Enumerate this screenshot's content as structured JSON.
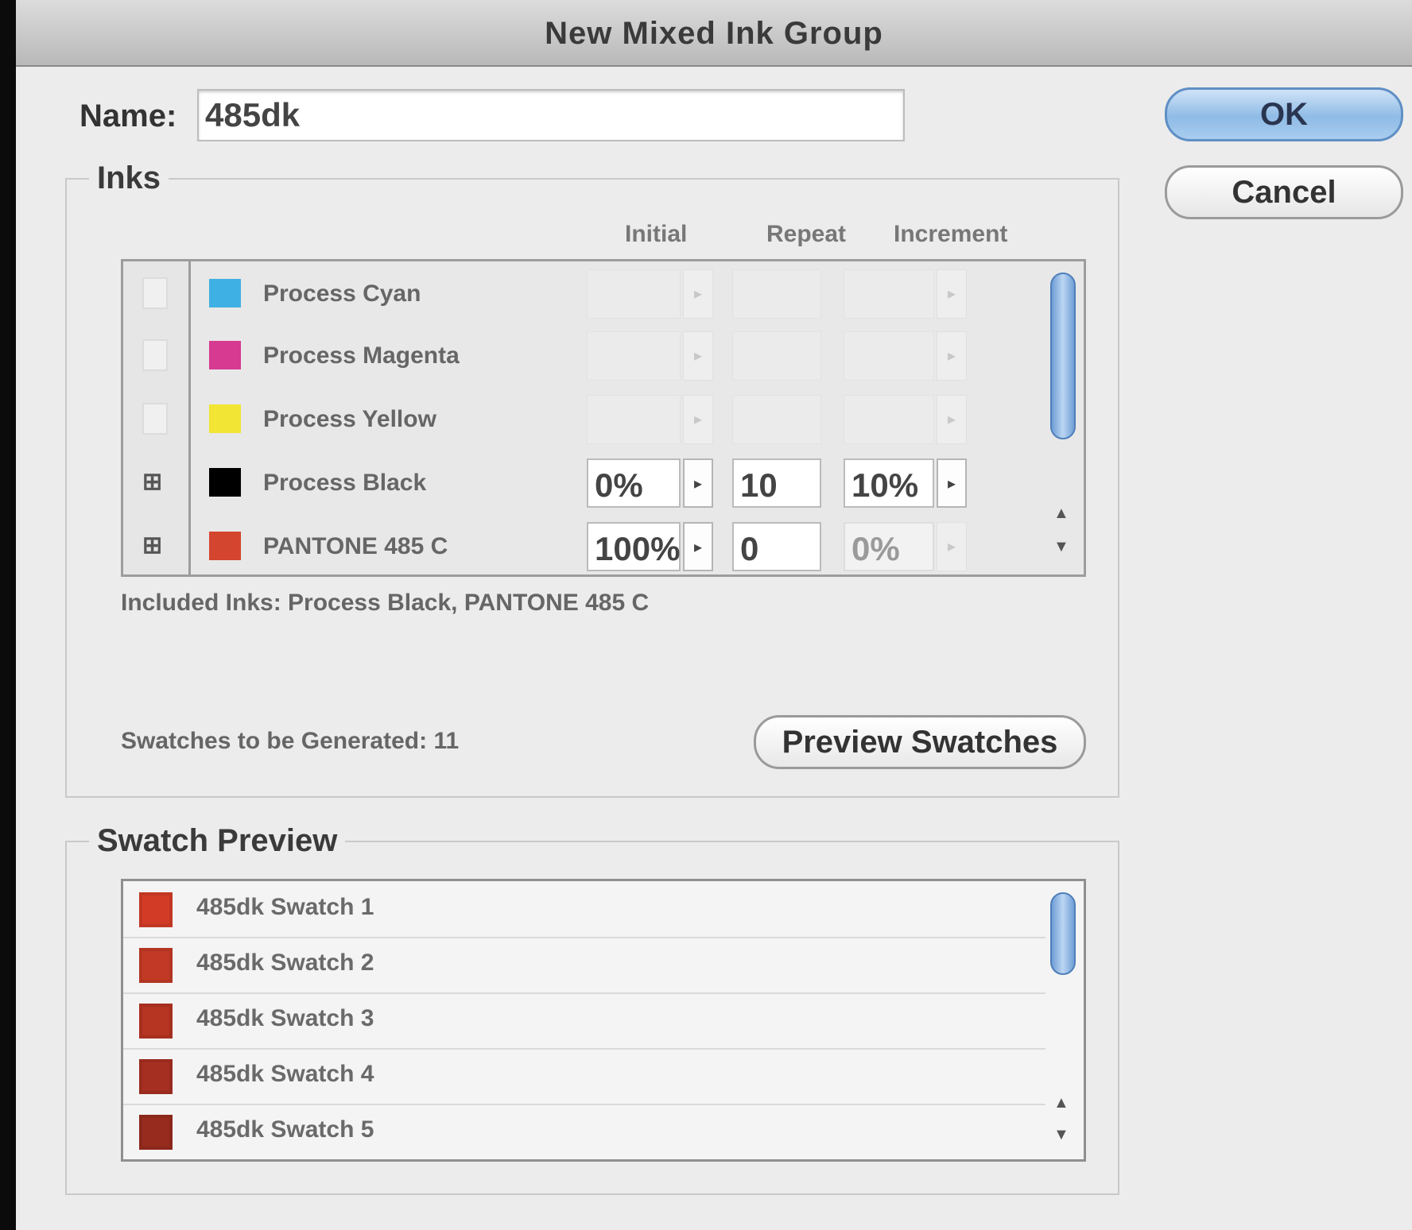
{
  "window": {
    "title": "New Mixed Ink Group"
  },
  "name": {
    "label": "Name:",
    "value": "485dk"
  },
  "buttons": {
    "ok": "OK",
    "cancel": "Cancel",
    "preview": "Preview Swatches"
  },
  "inks": {
    "group_title": "Inks",
    "columns": {
      "initial": "Initial",
      "repeat": "Repeat",
      "increment": "Increment"
    },
    "rows": [
      {
        "name": "Process Cyan",
        "color": "#3fb0e3",
        "included": false,
        "initial": "",
        "repeat": "",
        "increment": ""
      },
      {
        "name": "Process Magenta",
        "color": "#d63a91",
        "included": false,
        "initial": "",
        "repeat": "",
        "increment": ""
      },
      {
        "name": "Process Yellow",
        "color": "#f2e533",
        "included": false,
        "initial": "",
        "repeat": "",
        "increment": ""
      },
      {
        "name": "Process Black",
        "color": "#000000",
        "included": true,
        "initial": "0%",
        "repeat": "10",
        "increment": "10%"
      },
      {
        "name": "PANTONE 485 C",
        "color": "#d4452f",
        "included": true,
        "initial": "100%",
        "repeat": "0",
        "increment": "0%"
      }
    ],
    "included_text": "Included Inks: Process Black, PANTONE 485 C",
    "swatches_generated_text": "Swatches to be Generated: 11"
  },
  "swatch_preview": {
    "group_title": "Swatch Preview",
    "items": [
      {
        "label": "485dk Swatch 1",
        "color": "#d23c26"
      },
      {
        "label": "485dk Swatch 2",
        "color": "#c23a25"
      },
      {
        "label": "485dk Swatch 3",
        "color": "#b53422"
      },
      {
        "label": "485dk Swatch 4",
        "color": "#a52f21"
      },
      {
        "label": "485dk Swatch 5",
        "color": "#972b1e"
      }
    ]
  }
}
